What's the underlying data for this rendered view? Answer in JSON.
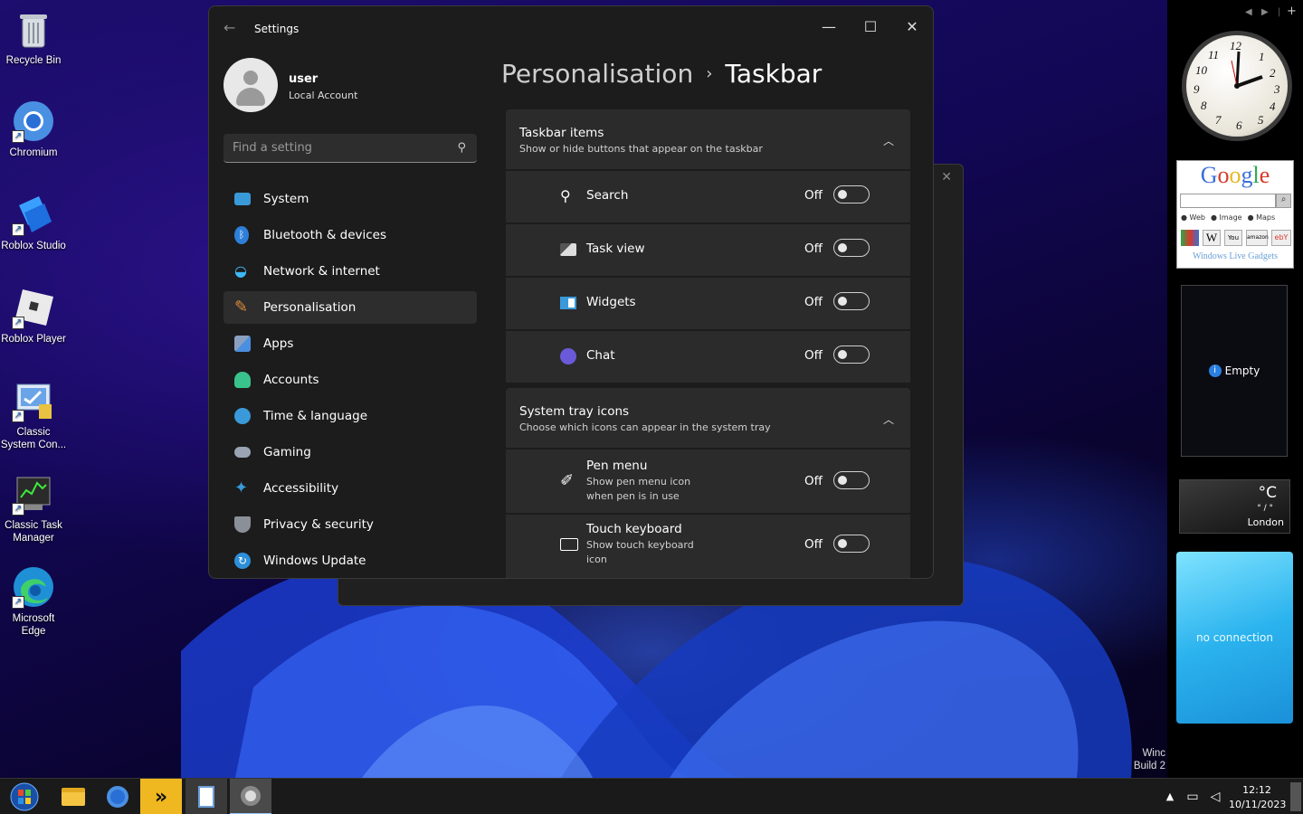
{
  "desktop": {
    "icons": [
      {
        "label": "Recycle Bin"
      },
      {
        "label": "Chromium"
      },
      {
        "label": "Roblox Studio"
      },
      {
        "label": "Roblox Player"
      },
      {
        "label": "Classic System Con..."
      },
      {
        "label": "Classic Task Manager"
      },
      {
        "label": "Microsoft Edge"
      }
    ],
    "watermark_line1": "Winc",
    "watermark_line2": "Build 2"
  },
  "gadgets": {
    "google_logo": "Google",
    "google_options": [
      "Web",
      "Image",
      "Maps"
    ],
    "google_footer": "Windows Live Gadgets",
    "empty_label": "Empty",
    "weather_unit": "°C",
    "weather_range": "° / °",
    "weather_city": "London",
    "connection_status": "no connection"
  },
  "settings": {
    "window_title": "Settings",
    "user": {
      "name": "user",
      "type": "Local Account"
    },
    "search_placeholder": "Find a setting",
    "nav": [
      {
        "label": "System",
        "color": "#3a9ad9"
      },
      {
        "label": "Bluetooth & devices",
        "color": "#2d7fd9"
      },
      {
        "label": "Network & internet",
        "color": "#3db8f5"
      },
      {
        "label": "Personalisation",
        "color": "#d98c3a"
      },
      {
        "label": "Apps",
        "color": "#7a8ca8"
      },
      {
        "label": "Accounts",
        "color": "#3ac28c"
      },
      {
        "label": "Time & language",
        "color": "#3a9ad9"
      },
      {
        "label": "Gaming",
        "color": "#9aa4b2"
      },
      {
        "label": "Accessibility",
        "color": "#3a9ad9"
      },
      {
        "label": "Privacy & security",
        "color": "#8a8f98"
      },
      {
        "label": "Windows Update",
        "color": "#2d8fd9"
      }
    ],
    "active_nav": "Personalisation",
    "breadcrumb": {
      "parent": "Personalisation",
      "separator": "›",
      "current": "Taskbar"
    },
    "taskbar_items": {
      "title": "Taskbar items",
      "subtitle": "Show or hide buttons that appear on the taskbar",
      "rows": [
        {
          "label": "Search",
          "state": "Off",
          "icon": "search-icon"
        },
        {
          "label": "Task view",
          "state": "Off",
          "icon": "task-view-icon"
        },
        {
          "label": "Widgets",
          "state": "Off",
          "icon": "widgets-icon"
        },
        {
          "label": "Chat",
          "state": "Off",
          "icon": "chat-icon"
        }
      ]
    },
    "tray_icons": {
      "title": "System tray icons",
      "subtitle": "Choose which icons can appear in the system tray",
      "rows": [
        {
          "label": "Pen menu",
          "sub1": "Show pen menu icon",
          "sub2": "when pen is in use",
          "state": "Off",
          "icon": "pen-icon"
        },
        {
          "label": "Touch keyboard",
          "sub1": "Show touch keyboard",
          "sub2": "icon",
          "state": "Off",
          "icon": "keyboard-icon"
        }
      ]
    }
  },
  "taskbar": {
    "time": "12:12",
    "date": "10/11/2023"
  }
}
